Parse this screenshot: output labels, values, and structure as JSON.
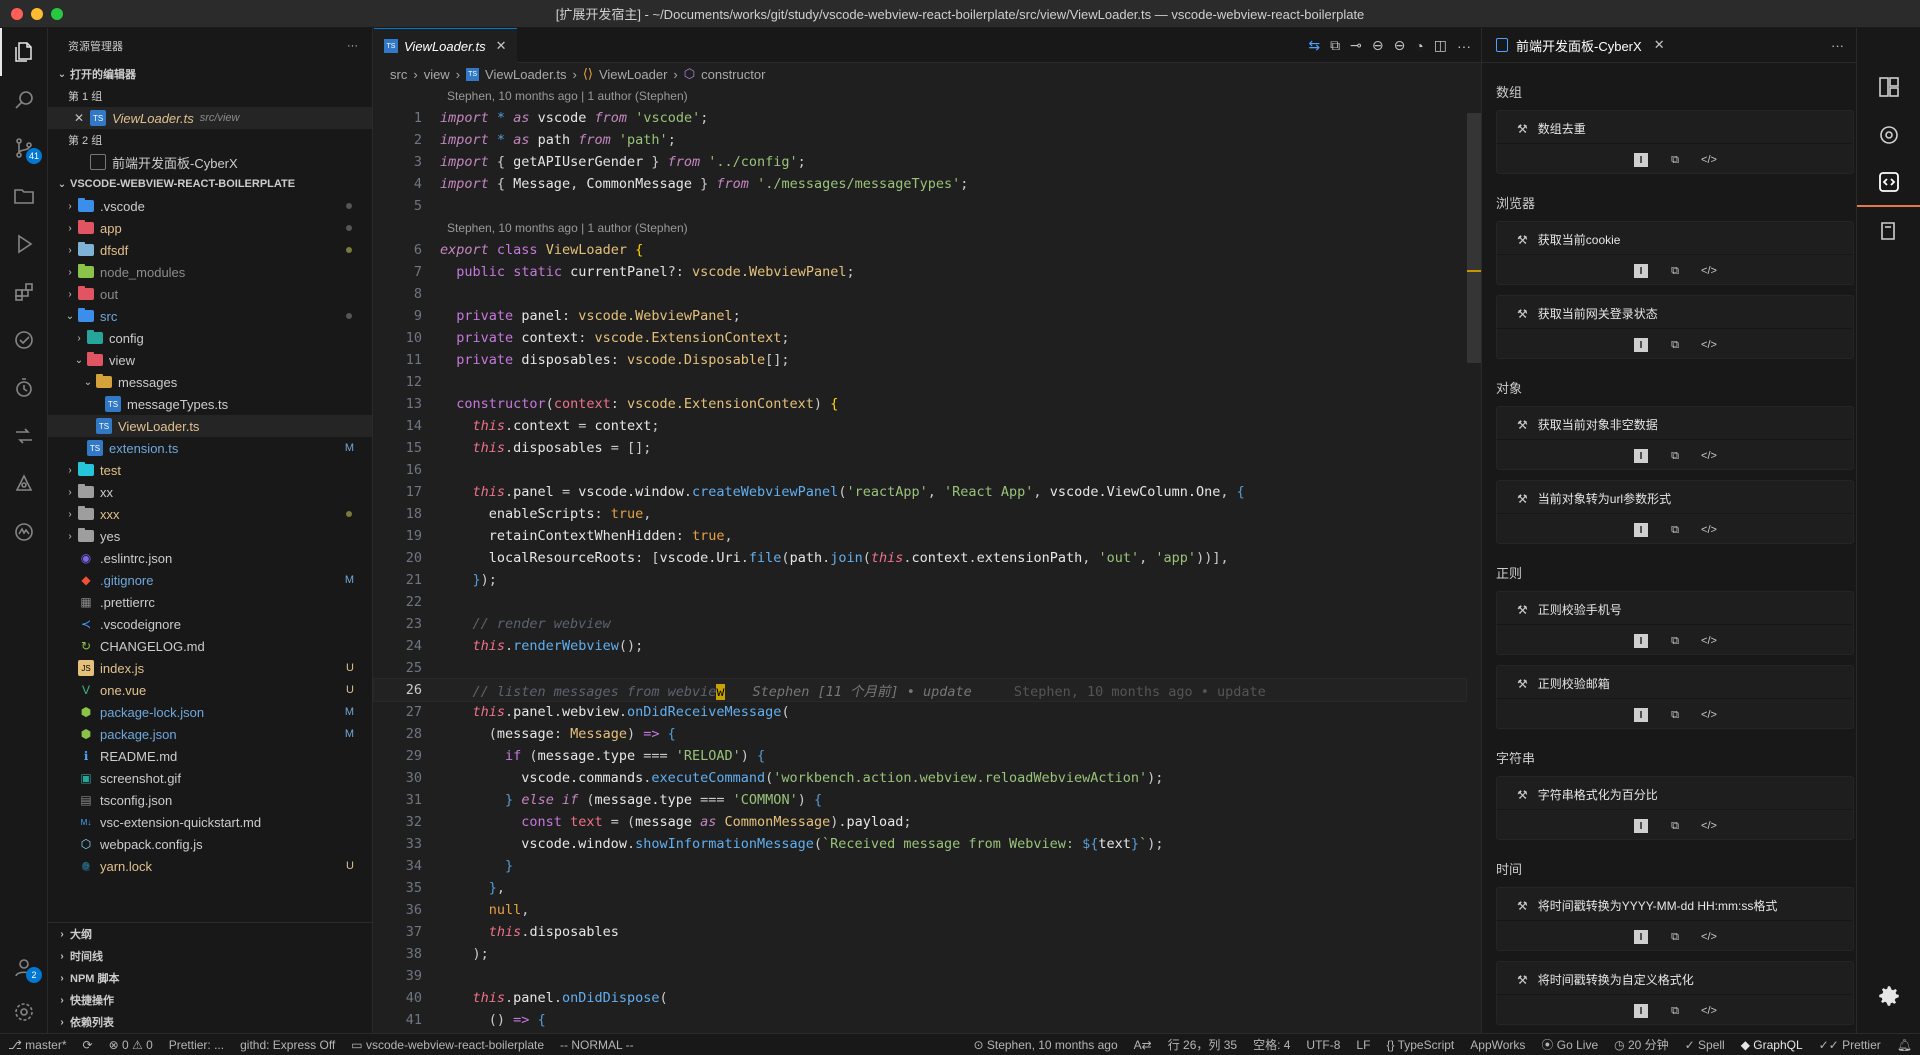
{
  "window": {
    "title": "[扩展开发宿主] - ~/Documents/works/git/study/vscode-webview-react-boilerplate/src/view/ViewLoader.ts — vscode-webview-react-boilerplate"
  },
  "activity": {
    "scm_badge": "41",
    "account_badge": "2"
  },
  "explorer": {
    "title": "资源管理器",
    "more": "···",
    "open_editors": {
      "label": "打开的编辑器",
      "group1": "第 1 组",
      "file1_name": "ViewLoader.ts",
      "file1_path": "src/view",
      "group2": "第 2 组",
      "file2_name": "前端开发面板-CyberX"
    },
    "project": {
      "label": "VSCODE-WEBVIEW-REACT-BOILERPLATE",
      "items": [
        {
          "name": ".vscode",
          "status": ""
        },
        {
          "name": "app",
          "status": ""
        },
        {
          "name": "dfsdf",
          "status": ""
        },
        {
          "name": "node_modules",
          "status": ""
        },
        {
          "name": "out",
          "status": ""
        },
        {
          "name": "src",
          "status": ""
        },
        {
          "name": "config",
          "status": ""
        },
        {
          "name": "view",
          "status": ""
        },
        {
          "name": "messages",
          "status": ""
        },
        {
          "name": "messageTypes.ts",
          "status": ""
        },
        {
          "name": "ViewLoader.ts",
          "status": ""
        },
        {
          "name": "extension.ts",
          "status": "M"
        },
        {
          "name": "test",
          "status": ""
        },
        {
          "name": "xx",
          "status": ""
        },
        {
          "name": "xxx",
          "status": ""
        },
        {
          "name": "yes",
          "status": ""
        },
        {
          "name": ".eslintrc.json",
          "status": ""
        },
        {
          "name": ".gitignore",
          "status": "M"
        },
        {
          "name": ".prettierrc",
          "status": ""
        },
        {
          "name": ".vscodeignore",
          "status": ""
        },
        {
          "name": "CHANGELOG.md",
          "status": ""
        },
        {
          "name": "index.js",
          "status": "U"
        },
        {
          "name": "one.vue",
          "status": "U"
        },
        {
          "name": "package-lock.json",
          "status": "M"
        },
        {
          "name": "package.json",
          "status": "M"
        },
        {
          "name": "README.md",
          "status": ""
        },
        {
          "name": "screenshot.gif",
          "status": ""
        },
        {
          "name": "tsconfig.json",
          "status": ""
        },
        {
          "name": "vsc-extension-quickstart.md",
          "status": ""
        },
        {
          "name": "webpack.config.js",
          "status": ""
        },
        {
          "name": "yarn.lock",
          "status": "U"
        }
      ]
    },
    "bottom": [
      "大纲",
      "时间线",
      "NPM 脚本",
      "快捷操作",
      "依赖列表"
    ]
  },
  "editor": {
    "tab_label": "ViewLoader.ts",
    "breadcrumb": [
      "src",
      "view",
      "ViewLoader.ts",
      "ViewLoader",
      "constructor"
    ],
    "codelens1": "Stephen, 10 months ago | 1 author (Stephen)",
    "codelens2": "Stephen, 10 months ago | 1 author (Stephen)",
    "blame_inline": "Stephen [11 个月前] • update",
    "blame_hover": "Stephen, 10 months ago • update",
    "current_line": "26"
  },
  "cyberx": {
    "tab_label": "前端开发面板-CyberX",
    "categories": [
      {
        "name": "数组",
        "tools": [
          "数组去重"
        ]
      },
      {
        "name": "浏览器",
        "tools": [
          "获取当前cookie",
          "获取当前网关登录状态"
        ]
      },
      {
        "name": "对象",
        "tools": [
          "获取当前对象非空数据",
          "当前对象转为url参数形式"
        ]
      },
      {
        "name": "正则",
        "tools": [
          "正则校验手机号",
          "正则校验邮箱"
        ]
      },
      {
        "name": "字符串",
        "tools": [
          "字符串格式化为百分比"
        ]
      },
      {
        "name": "时间",
        "tools": [
          "将时间戳转换为YYYY-MM-dd HH:mm:ss格式",
          "将时间戳转换为自定义格式化"
        ]
      }
    ]
  },
  "status": {
    "branch": "master*",
    "problems": "⊗ 0 ⚠ 0",
    "prettier": "Prettier: ...",
    "githd": "githd: Express Off",
    "folder": "vscode-webview-react-boilerplate",
    "mode": "-- NORMAL --",
    "blame": "Stephen, 10 months ago",
    "position": "行 26，列 35",
    "spaces": "空格: 4",
    "encoding": "UTF-8",
    "eol": "LF",
    "language": "TypeScript",
    "appworks": "AppWorks",
    "golive": "Go Live",
    "time": "20 分钟",
    "spell": "Spell",
    "graphql": "GraphQL",
    "prettier2": "Prettier"
  }
}
